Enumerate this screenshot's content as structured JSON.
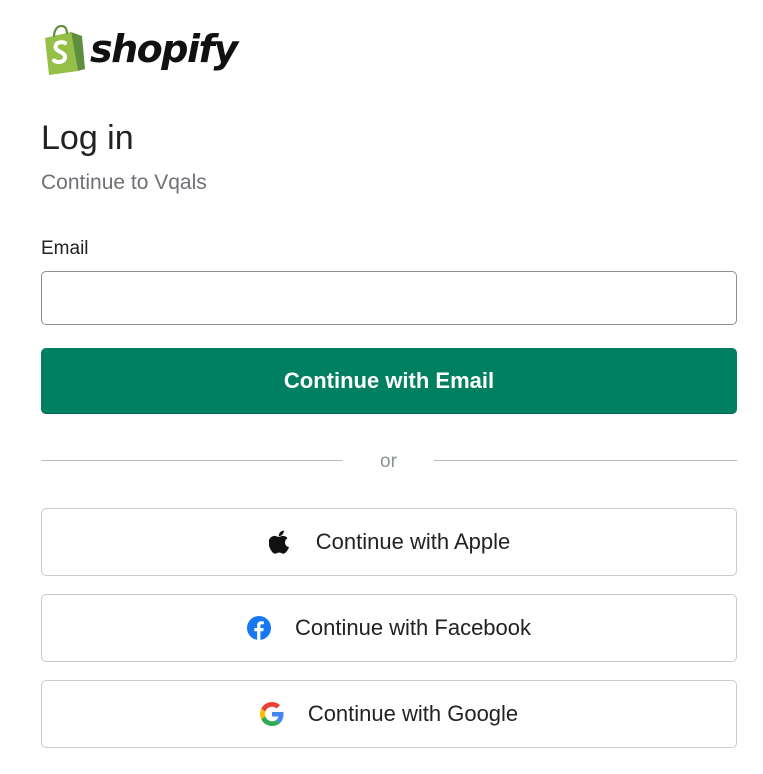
{
  "brand": {
    "name": "shopify",
    "logo_icon": "shopify-bag-icon",
    "logo_color": "#95bf47"
  },
  "login": {
    "title": "Log in",
    "subtitle": "Continue to Vqals",
    "email_label": "Email",
    "email_value": "",
    "email_placeholder": "",
    "continue_button": "Continue with Email",
    "divider_text": "or"
  },
  "social": [
    {
      "label": "Continue with Apple",
      "icon": "apple-icon"
    },
    {
      "label": "Continue with Facebook",
      "icon": "facebook-icon",
      "color": "#1877f2"
    },
    {
      "label": "Continue with Google",
      "icon": "google-icon"
    }
  ],
  "colors": {
    "primary": "#008060",
    "text": "#202223",
    "subdued": "#6d7175",
    "border": "#c9cccf"
  }
}
